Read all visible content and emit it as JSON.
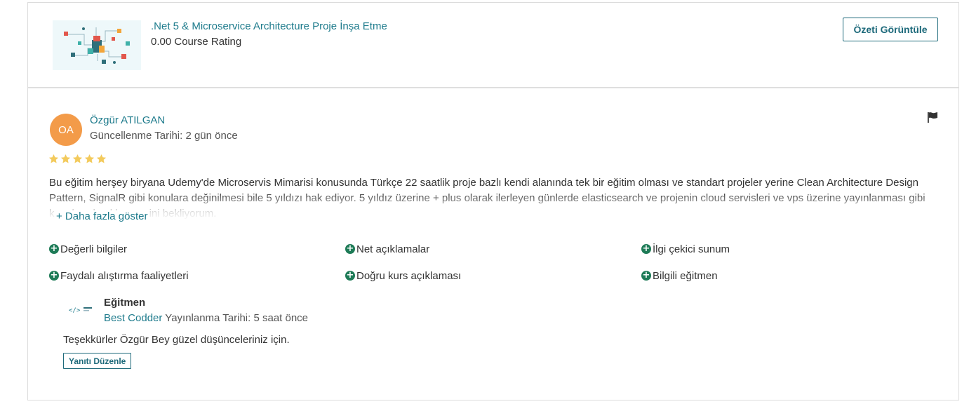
{
  "course": {
    "title": ".Net 5 & Microservice Architecture Proje İnşa Etme",
    "rating_text": "0.00 Course Rating",
    "summary_button": "Özeti Görüntüle"
  },
  "review": {
    "avatar_initials": "OA",
    "reviewer_name": "Özgür ATILGAN",
    "updated_text": "Güncellenme Tarihi: 2 gün önce",
    "rating": 5,
    "text": "Bu eğitim herşey biryana Udemy'de Microservis Mimarisi konusunda Türkçe 22 saatlik proje bazlı kendi alanında tek bir eğitim olması ve standart projeler yerine Clean Architecture Design Pattern, SignalR gibi konulara değinilmesi bile 5 yıldızı hak ediyor. 5 yıldız üzerine + plus olarak ilerleyen günlerde elasticsearch ve projenin cloud servisleri ve vps üzerine yayınlanması gibi konuları da eklenmesini bekliyorum.",
    "show_more": "+ Daha fazla göster",
    "tags": [
      "Değerli bilgiler",
      "Net açıklamalar",
      "İlgi çekici sunum",
      "Faydalı alıştırma faaliyetleri",
      "Doğru kurs açıklaması",
      "Bilgili eğitmen"
    ],
    "colors": {
      "accent": "#1e7b8c",
      "avatar": "#f39b49",
      "star": "#f3ca5c",
      "tag_icon": "#1e7b57"
    }
  },
  "reply": {
    "role": "Eğitmen",
    "author": "Best Codder",
    "published_text": "Yayınlanma Tarihi: 5 saat önce",
    "text": "Teşekkürler Özgür Bey güzel düşünceleriniz için.",
    "edit_button": "Yanıtı Düzenle"
  }
}
